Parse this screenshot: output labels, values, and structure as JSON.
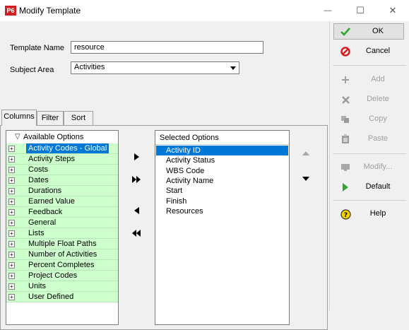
{
  "window": {
    "app_icon_text": "P6",
    "title": "Modify Template",
    "minimize_glyph": "—",
    "maximize_glyph": "☐",
    "close_glyph": "✕"
  },
  "form": {
    "template_name_label": "Template Name",
    "template_name_value": "resource",
    "subject_area_label": "Subject Area",
    "subject_area_value": "Activities"
  },
  "tabs": [
    {
      "label": "Columns",
      "active": true
    },
    {
      "label": "Filter",
      "active": false
    },
    {
      "label": "Sort",
      "active": false
    }
  ],
  "available": {
    "header": "Available Options",
    "collapse_glyph": "▽",
    "expander_glyph": "+",
    "items": [
      {
        "label": "Activity Codes - Global",
        "selected": true
      },
      {
        "label": "Activity Steps"
      },
      {
        "label": "Costs"
      },
      {
        "label": "Dates"
      },
      {
        "label": "Durations"
      },
      {
        "label": "Earned Value"
      },
      {
        "label": "Feedback"
      },
      {
        "label": "General"
      },
      {
        "label": "Lists"
      },
      {
        "label": "Multiple Float Paths"
      },
      {
        "label": "Number of Activities"
      },
      {
        "label": "Percent Completes"
      },
      {
        "label": "Project Codes"
      },
      {
        "label": "Units"
      },
      {
        "label": "User Defined"
      }
    ]
  },
  "selected": {
    "header": "Selected Options",
    "items": [
      {
        "label": "Activity ID",
        "selected": true
      },
      {
        "label": "Activity Status"
      },
      {
        "label": "WBS Code"
      },
      {
        "label": "Activity Name"
      },
      {
        "label": "Start"
      },
      {
        "label": "Finish"
      },
      {
        "label": "Resources"
      }
    ]
  },
  "side_buttons": {
    "ok": "OK",
    "cancel": "Cancel",
    "add": "Add",
    "delete": "Delete",
    "copy": "Copy",
    "paste": "Paste",
    "modify": "Modify...",
    "default": "Default",
    "help": "Help"
  },
  "icons": {
    "ok": "green-check-icon",
    "cancel": "red-circle-slash-icon",
    "add": "plus-icon",
    "delete": "x-icon",
    "copy": "copy-icon",
    "paste": "clipboard-icon",
    "modify": "monitor-icon",
    "default": "green-triangle-icon",
    "help": "help-question-icon"
  },
  "colors": {
    "selection": "#0078d7",
    "available_item_bg": "#ccffcc",
    "ok_check": "#2ea52e",
    "cancel": "#d42020",
    "app_icon": "#d21f1f"
  }
}
